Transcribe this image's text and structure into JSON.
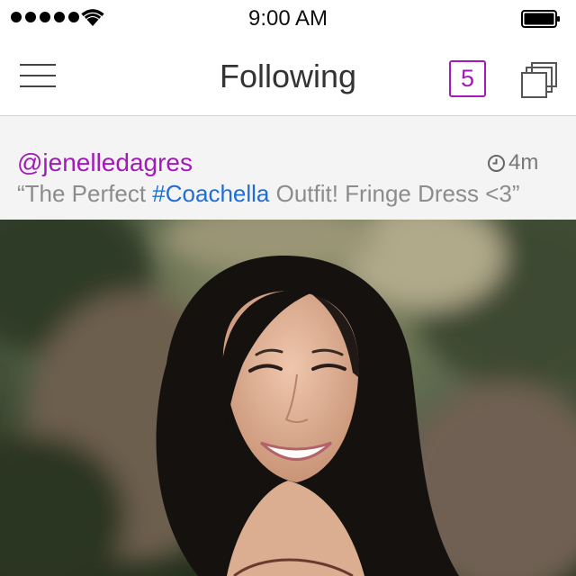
{
  "status_bar": {
    "time": "9:00 AM"
  },
  "nav_bar": {
    "title": "Following",
    "count": "5"
  },
  "post": {
    "username": "@jenelledagres",
    "age": "4m",
    "caption_prefix": "“The Perfect ",
    "hashtag": "#Coachella",
    "caption_suffix": " Outfit! Fringe Dress <3”"
  },
  "icons": {
    "signal": "signal-dots-icon",
    "wifi": "wifi-icon",
    "battery": "battery-icon",
    "menu": "menu-icon",
    "stack": "stack-icon",
    "clock": "clock-icon"
  },
  "colors": {
    "accent": "#a21ab8",
    "hashtag": "#1f6ed8",
    "caption_text": "#8c8c8c",
    "caption_bg": "#f4f4f4"
  }
}
